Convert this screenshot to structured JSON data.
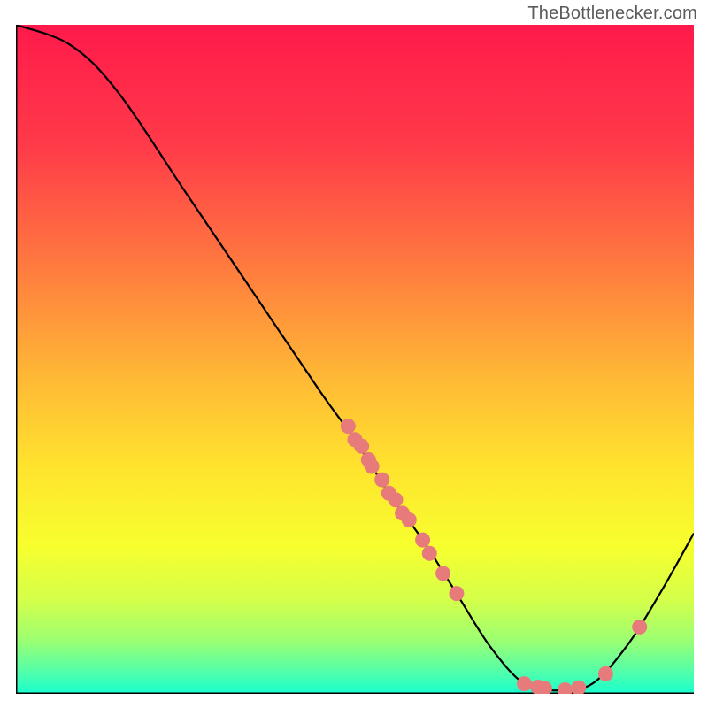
{
  "watermark": "TheBottleneсker.com",
  "chart_data": {
    "type": "line",
    "title": "",
    "xlabel": "",
    "ylabel": "",
    "xlim": [
      0,
      100
    ],
    "ylim": [
      0,
      100
    ],
    "curve": [
      {
        "x": 0,
        "y": 100
      },
      {
        "x": 8,
        "y": 97
      },
      {
        "x": 15,
        "y": 90
      },
      {
        "x": 25,
        "y": 75
      },
      {
        "x": 35,
        "y": 60
      },
      {
        "x": 45,
        "y": 45
      },
      {
        "x": 50,
        "y": 38
      },
      {
        "x": 55,
        "y": 30
      },
      {
        "x": 60,
        "y": 23
      },
      {
        "x": 65,
        "y": 15
      },
      {
        "x": 70,
        "y": 7
      },
      {
        "x": 75,
        "y": 1.5
      },
      {
        "x": 80,
        "y": 0.5
      },
      {
        "x": 85,
        "y": 1.5
      },
      {
        "x": 90,
        "y": 7
      },
      {
        "x": 95,
        "y": 15
      },
      {
        "x": 100,
        "y": 24
      }
    ],
    "points": [
      {
        "x": 49,
        "y": 40
      },
      {
        "x": 50,
        "y": 38
      },
      {
        "x": 51,
        "y": 37
      },
      {
        "x": 52,
        "y": 35
      },
      {
        "x": 52.5,
        "y": 34
      },
      {
        "x": 54,
        "y": 32
      },
      {
        "x": 55,
        "y": 30
      },
      {
        "x": 56,
        "y": 29
      },
      {
        "x": 57,
        "y": 27
      },
      {
        "x": 58,
        "y": 26
      },
      {
        "x": 60,
        "y": 23
      },
      {
        "x": 61,
        "y": 21
      },
      {
        "x": 63,
        "y": 18
      },
      {
        "x": 65,
        "y": 15
      },
      {
        "x": 75,
        "y": 1.5
      },
      {
        "x": 77,
        "y": 1.0
      },
      {
        "x": 78,
        "y": 0.8
      },
      {
        "x": 81,
        "y": 0.6
      },
      {
        "x": 83,
        "y": 0.9
      },
      {
        "x": 87,
        "y": 3.0
      },
      {
        "x": 92,
        "y": 10
      }
    ],
    "gradient_stops": [
      {
        "offset": 0.0,
        "color": "#ff1a4b"
      },
      {
        "offset": 0.18,
        "color": "#ff3a49"
      },
      {
        "offset": 0.36,
        "color": "#ff7a3f"
      },
      {
        "offset": 0.52,
        "color": "#ffb636"
      },
      {
        "offset": 0.66,
        "color": "#ffe32e"
      },
      {
        "offset": 0.78,
        "color": "#f7ff2e"
      },
      {
        "offset": 0.86,
        "color": "#d4ff4a"
      },
      {
        "offset": 0.92,
        "color": "#9cff72"
      },
      {
        "offset": 0.97,
        "color": "#4dffad"
      },
      {
        "offset": 1.0,
        "color": "#18ffce"
      }
    ],
    "point_color": "#e77b7b",
    "curve_color": "#000000"
  }
}
